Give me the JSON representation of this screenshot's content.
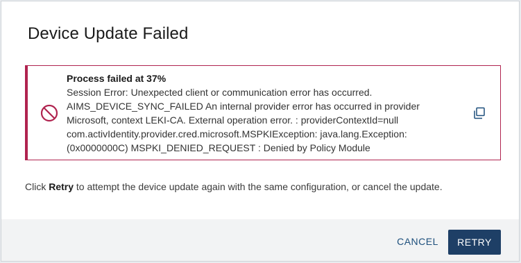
{
  "dialog": {
    "title": "Device Update Failed",
    "error": {
      "heading": "Process failed at 37%",
      "lines": [
        "Session Error: Unexpected client or communication error has occurred.",
        "AIMS_DEVICE_SYNC_FAILED An internal provider error has occurred in provider",
        "Microsoft, context LEKI-CA. External operation error. : providerContextId=null",
        "com.activIdentity.provider.cred.microsoft.MSPKIException: java.lang.Exception:",
        "(0x0000000C) MSPKI_DENIED_REQUEST : Denied by Policy Module"
      ],
      "status_icon": "no-entry-icon",
      "copy_icon": "copy-icon",
      "accent_color": "#b0234f"
    },
    "instruction": {
      "prefix": "Click ",
      "emphasis": "Retry",
      "suffix": " to attempt the device update again with the same configuration, or cancel the update."
    },
    "buttons": {
      "cancel_label": "CANCEL",
      "retry_label": "RETRY",
      "retry_color": "#1e3f66",
      "cancel_color": "#1d4f7c"
    }
  }
}
